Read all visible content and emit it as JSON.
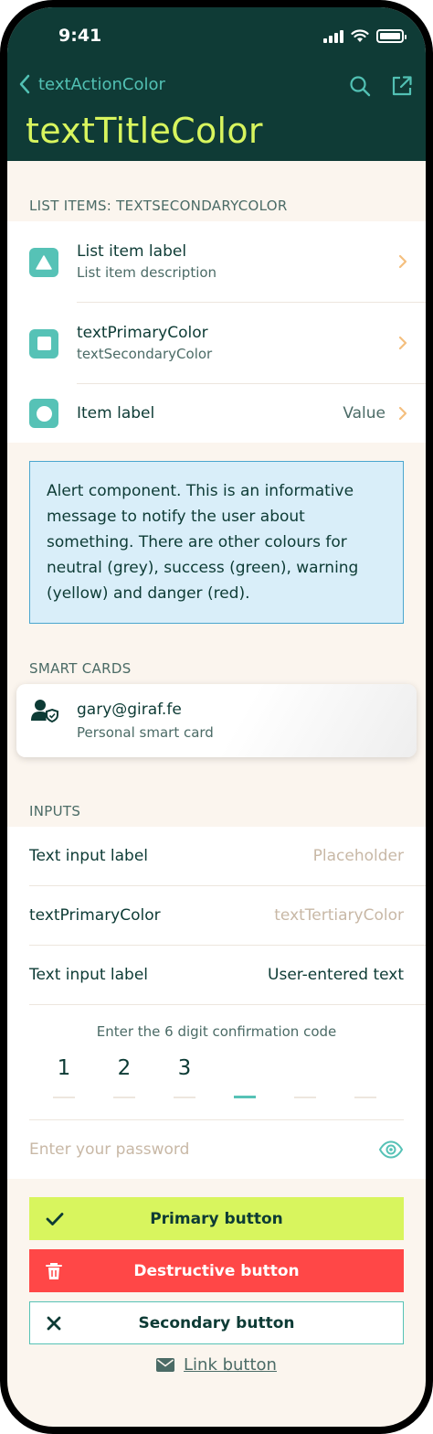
{
  "status_bar": {
    "time": "9:41"
  },
  "nav": {
    "back_label": "textActionColor",
    "title": "textTitleColor"
  },
  "list_section": {
    "title": "LIST ITEMS: TEXTSECONDARYCOLOR",
    "items": [
      {
        "label": "List item label",
        "description": "List item description",
        "icon": "triangle-icon"
      },
      {
        "label": "textPrimaryColor",
        "description": "textSecondaryColor",
        "icon": "square-icon"
      },
      {
        "label": "Item label",
        "value": "Value",
        "icon": "circle-icon"
      }
    ]
  },
  "alert": {
    "text": "Alert component. This is an informative message to notify the user about something. There are other colours for neutral (grey), success (green), warning (yellow) and danger (red)."
  },
  "smart_cards": {
    "title": "SMART CARDS",
    "card": {
      "email": "gary@giraf.fe",
      "subtitle": "Personal smart card"
    }
  },
  "inputs": {
    "title": "INPUTS",
    "fields": [
      {
        "label": "Text input label",
        "placeholder": "Placeholder"
      },
      {
        "label": "textPrimaryColor",
        "placeholder": "textTertiaryColor"
      },
      {
        "label": "Text input label",
        "value": "User-entered text"
      }
    ],
    "code": {
      "hint": "Enter the 6 digit confirmation code",
      "digits": [
        "1",
        "2",
        "3",
        "",
        "",
        ""
      ]
    },
    "password": {
      "placeholder": "Enter your password"
    }
  },
  "buttons": {
    "primary": "Primary button",
    "destructive": "Destructive button",
    "secondary": "Secondary button",
    "link": "Link button"
  },
  "colors": {
    "header_bg": "#0f3b36",
    "title": "#d8f55e",
    "action": "#52c1b4",
    "accent": "#56c2b6",
    "danger": "#ff4747",
    "background": "#fbf5ee"
  }
}
